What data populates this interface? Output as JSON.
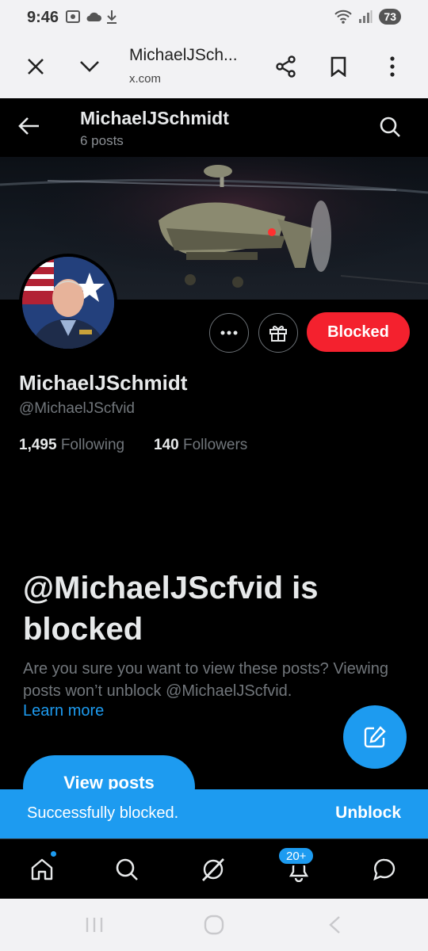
{
  "status_bar": {
    "time": "9:46",
    "battery": "73"
  },
  "browser": {
    "title": "MichaelJSch...",
    "url": "x.com"
  },
  "header": {
    "name": "MichaelJSchmidt",
    "posts": "6 posts"
  },
  "profile": {
    "display_name": "MichaelJSchmidt",
    "handle": "@MichaelJScfvid",
    "following_count": "1,495",
    "following_label": "Following",
    "followers_count": "140",
    "followers_label": "Followers",
    "blocked_button": "Blocked"
  },
  "blocked_notice": {
    "title": "@MichaelJScfvid is blocked",
    "description": "Are you sure you want to view these posts? Viewing posts won’t unblock @MichaelJScfvid.",
    "learn_more": "Learn more",
    "view_posts": "View posts"
  },
  "toast": {
    "message": "Successfully blocked.",
    "action": "Unblock"
  },
  "tabbar": {
    "notifications_badge": "20+"
  },
  "colors": {
    "accent": "#1d9bf0",
    "blocked": "#f4212e",
    "background": "#000000"
  }
}
